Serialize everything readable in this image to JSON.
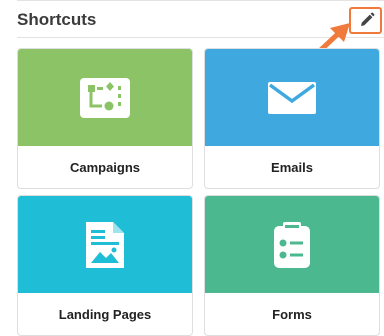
{
  "header": {
    "title": "Shortcuts",
    "edit_icon": "pencil-icon"
  },
  "tiles": [
    {
      "label": "Campaigns",
      "color": "#8cc366",
      "icon": "campaign-flow-icon"
    },
    {
      "label": "Emails",
      "color": "#3ea8df",
      "icon": "envelope-icon"
    },
    {
      "label": "Landing Pages",
      "color": "#1fbdd6",
      "icon": "landing-page-icon"
    },
    {
      "label": "Forms",
      "color": "#4bb890",
      "icon": "form-clipboard-icon"
    }
  ],
  "colors": {
    "accent": "#f07a3c",
    "header_text": "#3b3b3b"
  }
}
